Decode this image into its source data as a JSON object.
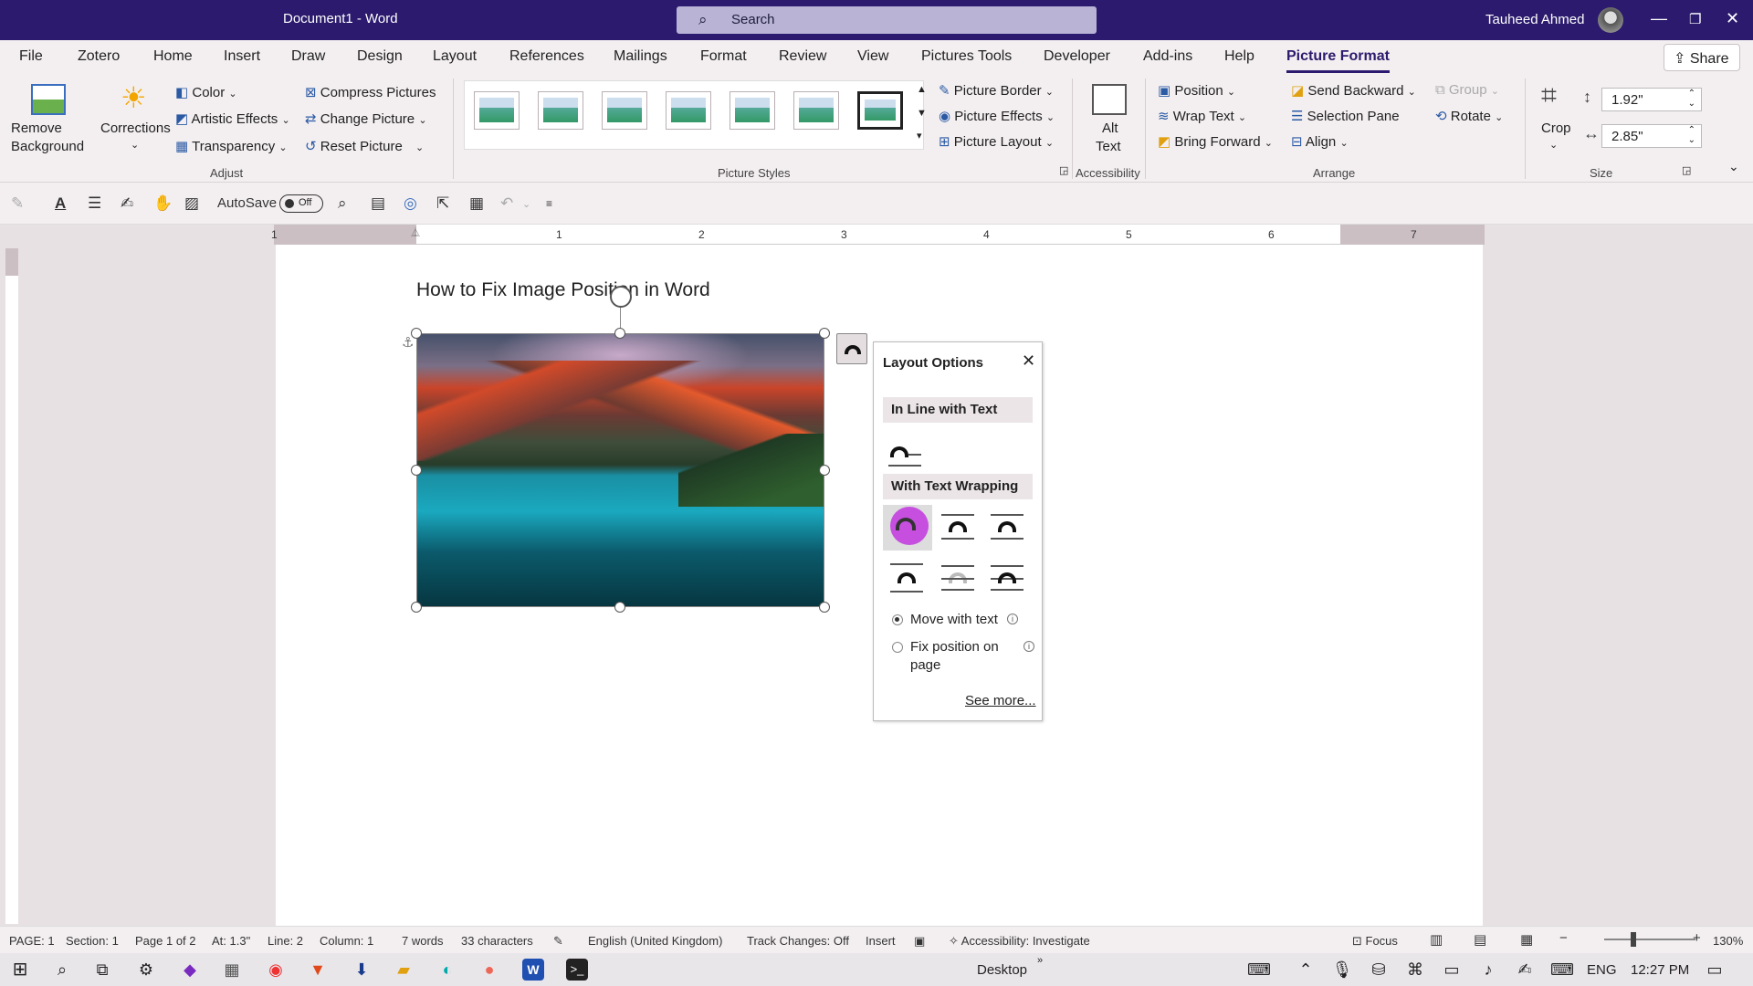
{
  "titlebar": {
    "doc": "Document1  -  Word",
    "search": "Search",
    "user": "Tauheed Ahmed"
  },
  "menu": [
    "File",
    "Zotero",
    "Home",
    "Insert",
    "Draw",
    "Design",
    "Layout",
    "References",
    "Mailings",
    "Format",
    "Review",
    "View",
    "Pictures Tools",
    "Developer",
    "Add-ins",
    "Help",
    "Picture Format"
  ],
  "share": "Share",
  "ribbon": {
    "remove_bg": [
      "Remove",
      "Background"
    ],
    "corrections": "Corrections",
    "color": "Color",
    "artistic": "Artistic Effects",
    "transparency": "Transparency",
    "compress": "Compress Pictures",
    "change": "Change Picture",
    "reset": "Reset Picture",
    "adjust": "Adjust",
    "picture_styles": "Picture Styles",
    "border": "Picture Border",
    "effects": "Picture Effects",
    "layout": "Picture Layout",
    "alt": [
      "Alt",
      "Text"
    ],
    "accessibility": "Accessibility",
    "position": "Position",
    "wrap": "Wrap Text",
    "bring": "Bring Forward",
    "send": "Send Backward",
    "selection": "Selection Pane",
    "align": "Align",
    "group": "Group",
    "rotate": "Rotate",
    "arrange": "Arrange",
    "crop": "Crop",
    "height": "1.92\"",
    "width": "2.85\"",
    "size": "Size"
  },
  "qat": {
    "autosave": "AutoSave",
    "toggle": "Off"
  },
  "ruler": [
    "1",
    "1",
    "2",
    "3",
    "4",
    "5",
    "6",
    "7"
  ],
  "document": {
    "title": "How to Fix Image Position in Word"
  },
  "layout_panel": {
    "title": "Layout Options",
    "inline": "In Line with Text",
    "wrapping": "With Text Wrapping",
    "move": "Move with text",
    "fix": [
      "Fix position on",
      "page"
    ],
    "see_more": "See more..."
  },
  "status": {
    "page": "PAGE: 1",
    "section": "Section: 1",
    "pageof": "Page 1 of 2",
    "at": "At: 1.3\"",
    "line": "Line: 2",
    "column": "Column: 1",
    "words": "7 words",
    "chars": "33 characters",
    "lang": "English (United Kingdom)",
    "track": "Track Changes: Off",
    "insert": "Insert",
    "acc": "Accessibility: Investigate",
    "focus": "Focus",
    "zoom": "130%"
  },
  "taskbar": {
    "desktop": "Desktop",
    "lang": "ENG",
    "time": "12:27 PM"
  },
  "colors": {
    "title": "#2b1a6d",
    "accent": "#c33fe0"
  }
}
